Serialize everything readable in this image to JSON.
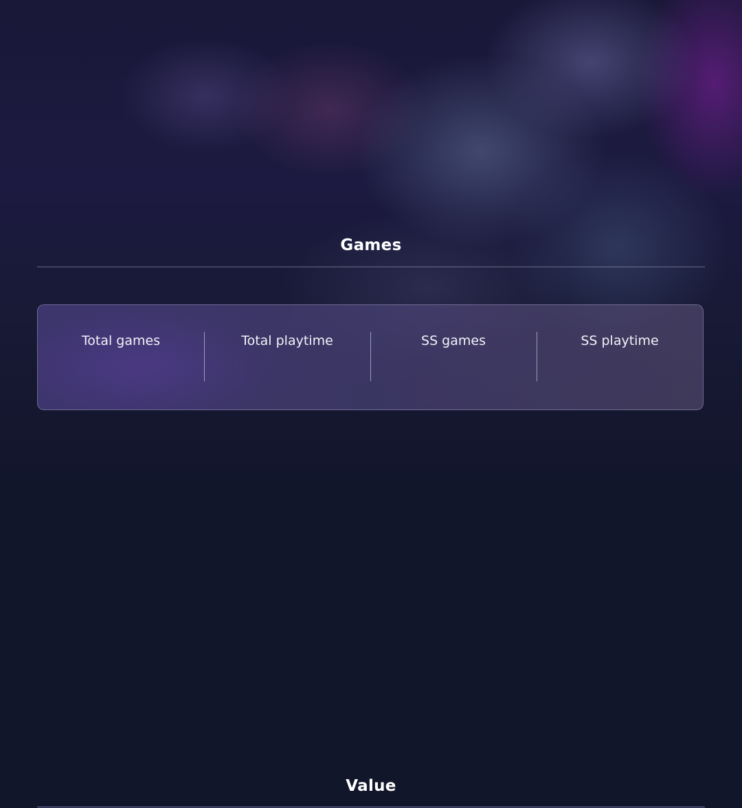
{
  "sections": {
    "games": {
      "title": "Games",
      "stats": [
        {
          "label": "Total games",
          "value": ""
        },
        {
          "label": "Total playtime",
          "value": ""
        },
        {
          "label": "SS games",
          "value": ""
        },
        {
          "label": "SS playtime",
          "value": ""
        }
      ]
    },
    "value": {
      "title": "Value"
    }
  }
}
